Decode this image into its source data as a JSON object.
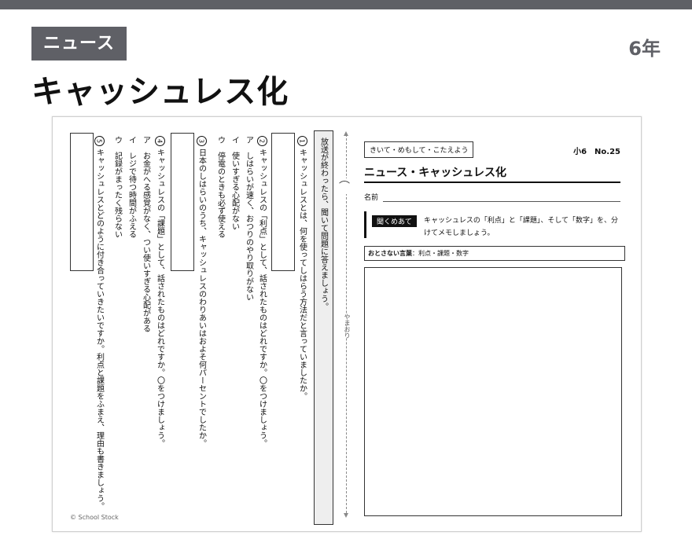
{
  "header": {
    "badge": "ニュース",
    "grade": "6年",
    "title": "キャッシュレス化"
  },
  "worksheet": {
    "instruction": "放送が終わったら、聞いて問題に答えましょう。",
    "fold_label": "やまおり",
    "copyright": "© School Stock",
    "tag": "きいて・めもして・こたえよう",
    "number": "小6　No.25",
    "title": "ニュース・キャッシュレス化",
    "name_label": "名前",
    "listen_label": "聞くめあて",
    "listen_text": "キャッシュレスの「利点」と「課題」、そして「数字」を、分けてメモしましょう。",
    "words_label": "おとさない言葉",
    "words_text": "：利点・課題・数字"
  },
  "questions": {
    "q1": {
      "num": "1",
      "text": "キャッシュレスとは、何を使ってしはらう方法だと言っていましたか。"
    },
    "q2": {
      "num": "2",
      "text": "キャッシュレスの「利点」として、話されたものはどれですか。〇をつけましょう。",
      "options": [
        "ア　しはらいが速く、おつりのやり取りがない",
        "イ　使いすぎる心配がない",
        "ウ　停電のときも必ず使える"
      ]
    },
    "q3": {
      "num": "3",
      "text": "日本のしはらいのうち、キャッシュレスのわりあいはおよそ何パーセントでしたか。"
    },
    "q4": {
      "num": "4",
      "text": "キャッシュレスの「課題」として、話されたものはどれですか。〇をつけましょう。",
      "options": [
        "ア　お金がへる感覚がなく、つい使いすぎる心配がある",
        "イ　レジで待つ時間がふえる",
        "ウ　記録がまったく残らない"
      ]
    },
    "q5": {
      "num": "5",
      "text": "キャッシュレスとどのように付き合っていきたいですか。利点と課題をふまえ、理由も書きましょう。"
    }
  }
}
